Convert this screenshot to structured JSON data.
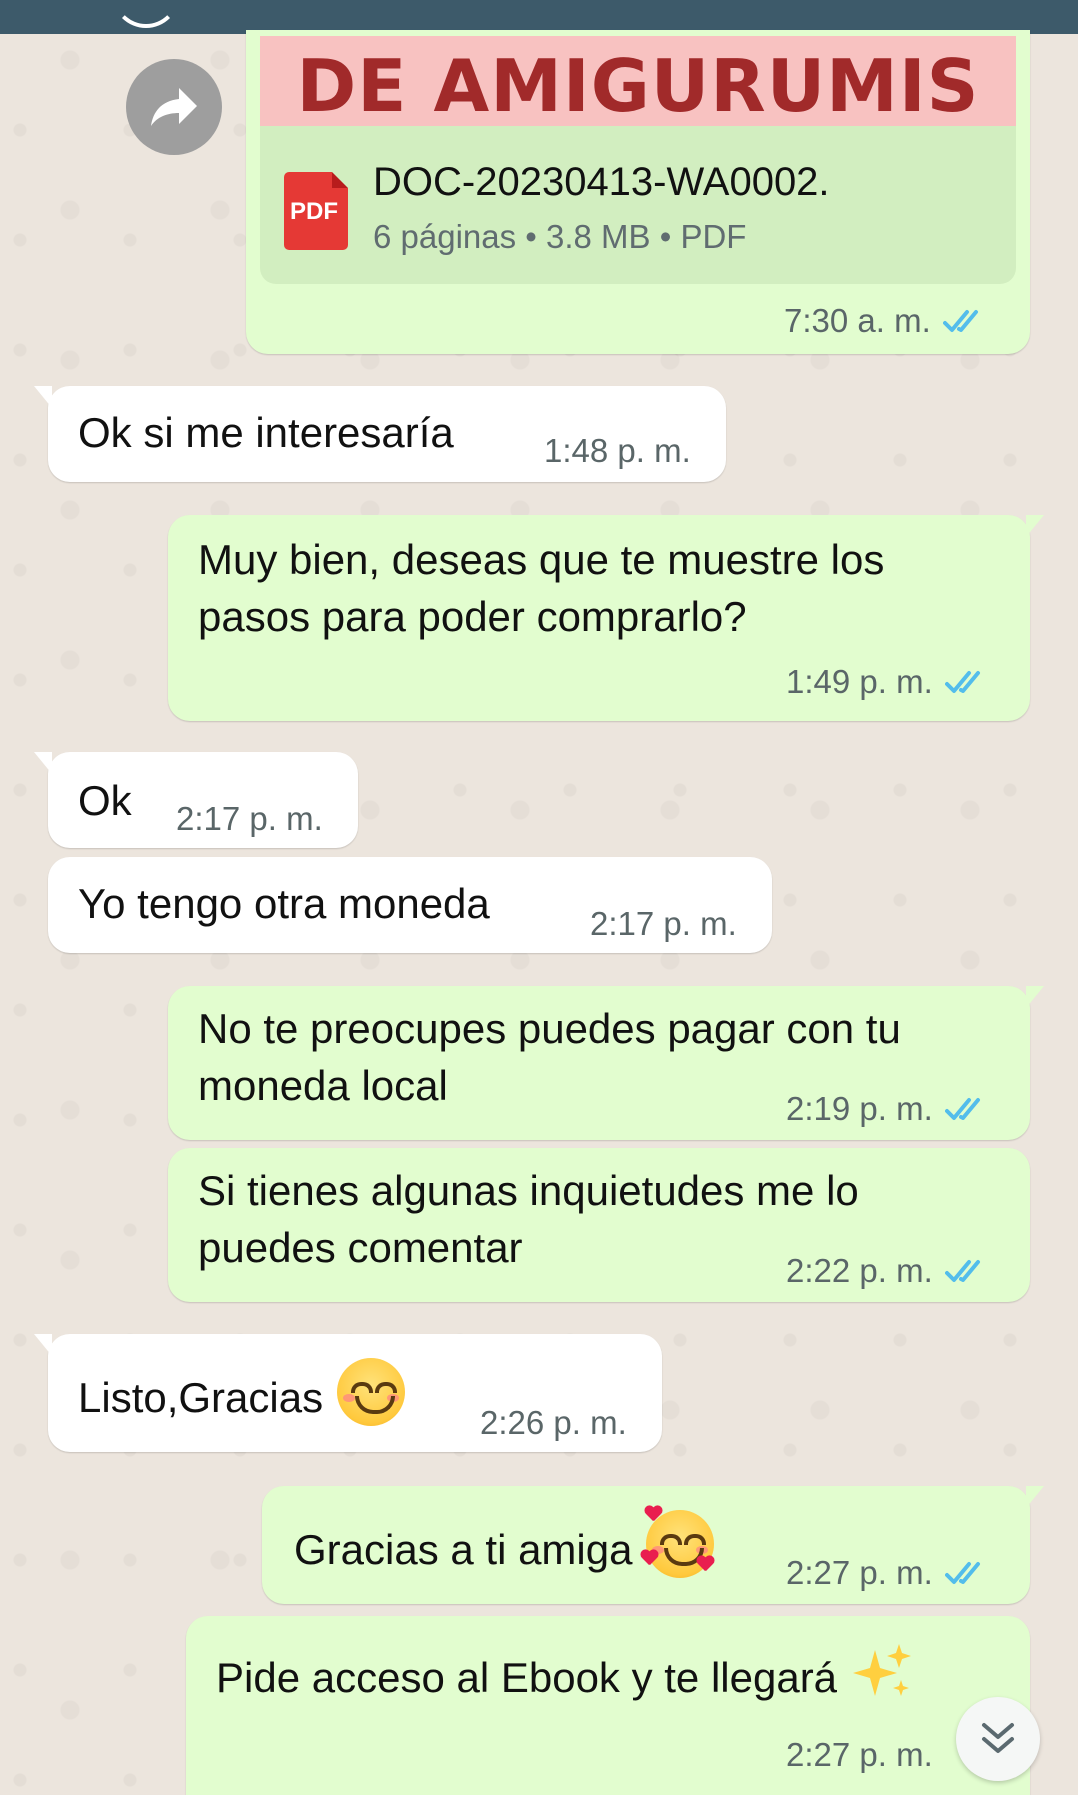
{
  "document_message": {
    "title_banner": "DE AMIGURUMIS",
    "pdf_badge": "PDF",
    "file_name": "DOC-20230413-WA0002.",
    "file_info": "6 páginas • 3.8 MB • PDF",
    "time": "7:30 a. m."
  },
  "messages": [
    {
      "direction": "in",
      "text": "Ok si me interesaría",
      "time": "1:48 p. m."
    },
    {
      "direction": "out",
      "line1": "Muy bien, deseas que te muestre los",
      "line2": "pasos para poder comprarlo?",
      "time": "1:49 p. m."
    },
    {
      "direction": "in",
      "text": "Ok",
      "time": "2:17 p. m."
    },
    {
      "direction": "in",
      "text": "Yo tengo otra moneda",
      "time": "2:17 p. m."
    },
    {
      "direction": "out",
      "line1": "No te preocupes puedes pagar con tu",
      "line2": "moneda local",
      "time": "2:19 p. m."
    },
    {
      "direction": "out",
      "line1": "Si tienes algunas inquietudes me lo",
      "line2": "puedes comentar",
      "time": "2:22 p. m."
    },
    {
      "direction": "in",
      "text": "Listo,Gracias",
      "emoji": "smiling-face",
      "time": "2:26 p. m."
    },
    {
      "direction": "out",
      "text": "Gracias a ti amiga",
      "emoji": "smiling-face-with-hearts",
      "time": "2:27 p. m."
    },
    {
      "direction": "out",
      "text": "Pide acceso al Ebook y te llegará",
      "emoji": "sparkles",
      "time": "2:27 p. m."
    }
  ],
  "icons": {
    "forward": "forward-arrow-icon",
    "read_receipt": "double-check-icon",
    "scroll_down": "double-chevron-down-icon"
  },
  "colors": {
    "outgoing_bubble": "#e2fdcf",
    "incoming_bubble": "#ffffff",
    "read_tick": "#53bdeb",
    "title_banner_bg": "#f8c2c1",
    "title_banner_text": "#a12a2a",
    "header_bar": "#3d5a6a"
  }
}
